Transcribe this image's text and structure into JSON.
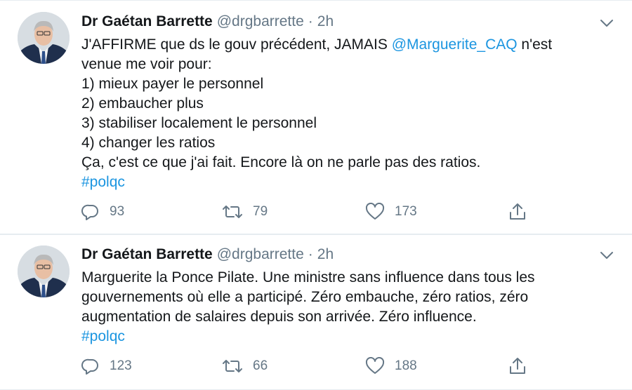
{
  "tweets": [
    {
      "author_name": "Dr Gaétan Barrette",
      "handle": "@drgbarrette",
      "separator": "·",
      "time": "2h",
      "lines": [
        {
          "before": "J'AFFIRME que ds le gouv précédent, JAMAIS ",
          "link": "@Marguerite_CAQ",
          "after": " n'est"
        },
        {
          "before": "venue me voir pour:",
          "link": "",
          "after": ""
        },
        {
          "before": "1) mieux payer le personnel",
          "link": "",
          "after": ""
        },
        {
          "before": "2) embaucher plus",
          "link": "",
          "after": ""
        },
        {
          "before": "3) stabiliser localement le personnel",
          "link": "",
          "after": ""
        },
        {
          "before": "4) changer les ratios",
          "link": "",
          "after": ""
        },
        {
          "before": "Ça, c'est ce que j'ai fait. Encore là on ne parle pas des ratios.",
          "link": "",
          "after": ""
        },
        {
          "before": "",
          "link": "#polqc",
          "after": ""
        }
      ],
      "replies": "93",
      "retweets": "79",
      "likes": "173"
    },
    {
      "author_name": "Dr Gaétan Barrette",
      "handle": "@drgbarrette",
      "separator": "·",
      "time": "2h",
      "lines": [
        {
          "before": "Marguerite la Ponce Pilate. Une ministre sans influence dans tous les",
          "link": "",
          "after": ""
        },
        {
          "before": "gouvernements où elle a participé. Zéro embauche, zéro ratios, zéro",
          "link": "",
          "after": ""
        },
        {
          "before": "augmentation de salaires depuis son arrivée. Zéro influence.",
          "link": "",
          "after": ""
        },
        {
          "before": "",
          "link": "#polqc",
          "after": ""
        }
      ],
      "replies": "123",
      "retweets": "66",
      "likes": "188"
    }
  ],
  "icons": {
    "reply": "reply-icon",
    "retweet": "retweet-icon",
    "like": "heart-icon",
    "share": "share-icon",
    "menu": "chevron-down-icon"
  },
  "colors": {
    "link": "#1b95e0",
    "secondary_text": "#657786",
    "divider": "#e6ecf0"
  }
}
